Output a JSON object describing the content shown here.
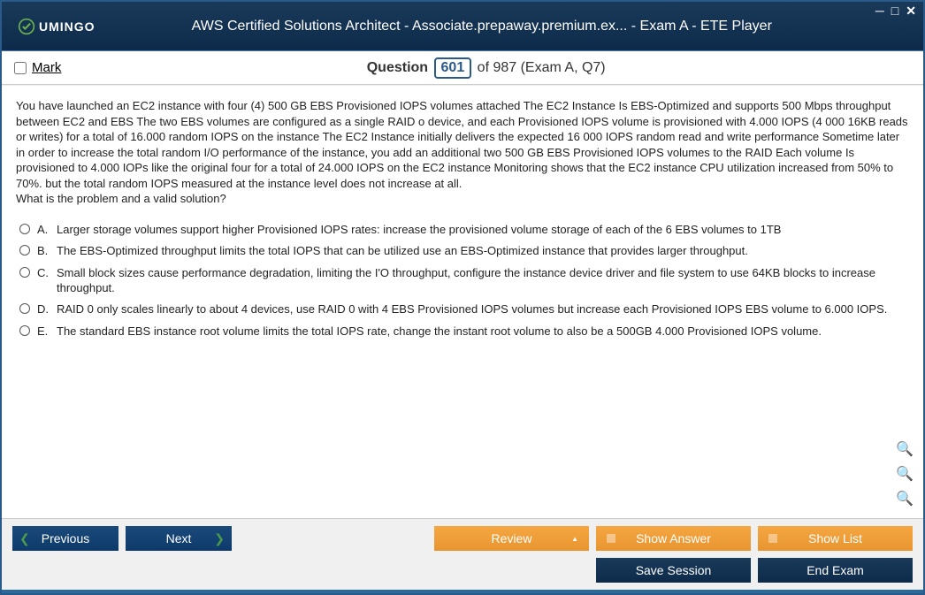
{
  "window": {
    "brand": "UMINGO",
    "title": "AWS Certified Solutions Architect - Associate.prepaway.premium.ex... - Exam A - ETE Player"
  },
  "header": {
    "mark_label": "Mark",
    "question_word": "Question",
    "current_number": "601",
    "total_text": "of 987 (Exam A, Q7)"
  },
  "question": {
    "text": "You have launched an EC2 instance with four (4) 500 GB EBS Provisioned IOPS volumes attached The EC2 Instance Is EBS-Optimized and supports 500 Mbps throughput between EC2 and EBS The two EBS volumes are configured as a single RAID o device, and each Provisioned IOPS volume is provisioned with 4.000 IOPS (4 000 16KB reads or writes) for a total of 16.000 random IOPS on the instance The EC2 Instance initially delivers the expected 16 000 IOPS random read and write performance Sometime later in order to increase the total random I/O performance of the instance, you add an additional two 500 GB EBS Provisioned IOPS volumes to the RAID Each volume Is provisioned to 4.000 IOPs like the original four for a total of 24.000 IOPS on the EC2 instance Monitoring shows that the EC2 instance CPU utilization increased from 50% to 70%. but the total random IOPS measured at the instance level does not increase at all.",
    "prompt": "What is the problem and a valid solution?",
    "options": [
      {
        "letter": "A.",
        "text": "Larger storage volumes support higher Provisioned IOPS rates: increase the provisioned volume storage of each of the 6 EBS volumes to 1TB"
      },
      {
        "letter": "B.",
        "text": "The EBS-Optimized throughput limits the total IOPS that can be utilized use an EBS-Optimized instance that provides larger throughput."
      },
      {
        "letter": "C.",
        "text": "Small block sizes cause performance degradation, limiting the I'O throughput, configure the instance device driver and file system to use 64KB blocks to increase throughput."
      },
      {
        "letter": "D.",
        "text": "RAID 0 only scales linearly to about 4 devices, use RAID 0 with 4 EBS Provisioned IOPS volumes but increase each Provisioned IOPS EBS volume to 6.000 IOPS."
      },
      {
        "letter": "E.",
        "text": "The standard EBS instance root volume limits the total IOPS rate, change the instant root volume to also be a 500GB 4.000 Provisioned IOPS volume."
      }
    ]
  },
  "footer": {
    "previous": "Previous",
    "next": "Next",
    "review": "Review",
    "show_answer": "Show Answer",
    "show_list": "Show List",
    "save_session": "Save Session",
    "end_exam": "End Exam"
  }
}
